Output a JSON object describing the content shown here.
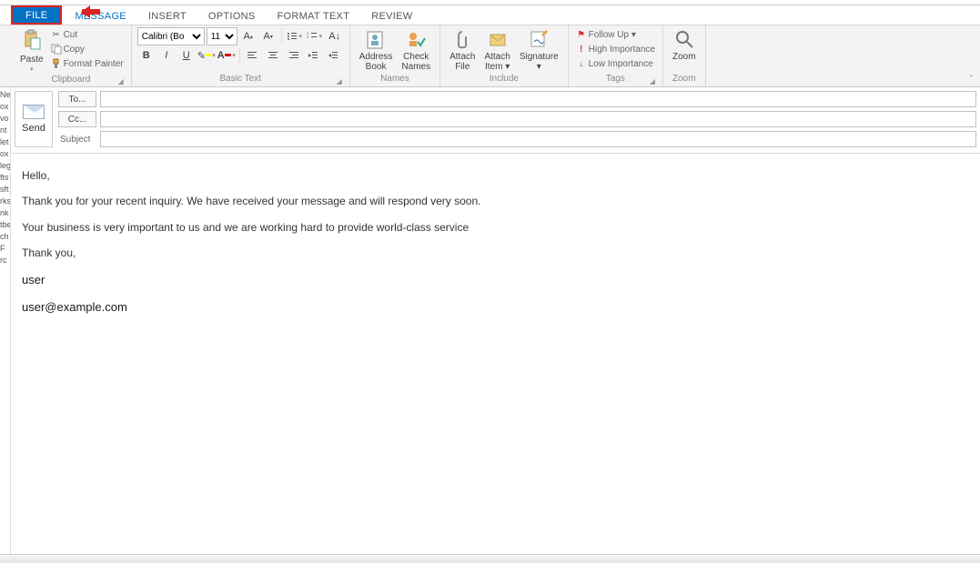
{
  "tabs": {
    "file": "FILE",
    "message": "MESSAGE",
    "insert": "INSERT",
    "options": "OPTIONS",
    "format_text": "FORMAT TEXT",
    "review": "REVIEW"
  },
  "ribbon": {
    "clipboard": {
      "paste": "Paste",
      "cut": "Cut",
      "copy": "Copy",
      "format_painter": "Format Painter",
      "group_label": "Clipboard"
    },
    "basic_text": {
      "font_name": "Calibri (Bo",
      "font_size": "11",
      "group_label": "Basic Text"
    },
    "names": {
      "address_book": "Address\nBook",
      "check_names": "Check\nNames",
      "group_label": "Names"
    },
    "include": {
      "attach_file": "Attach\nFile",
      "attach_item": "Attach\nItem ▾",
      "signature": "Signature\n▾",
      "group_label": "Include"
    },
    "tags": {
      "follow_up": "Follow Up ▾",
      "high": "High Importance",
      "low": "Low Importance",
      "group_label": "Tags"
    },
    "zoom": {
      "zoom": "Zoom",
      "group_label": "Zoom"
    }
  },
  "compose": {
    "send": "Send",
    "to_btn": "To...",
    "cc_btn": "Cc...",
    "subject_label": "Subject",
    "to_value": "",
    "cc_value": "",
    "subject_value": ""
  },
  "message_body": {
    "hello": "Hello,",
    "line1": "Thank you for your recent inquiry. We have received your message and will respond very soon.",
    "line2": "Your business is very important to us and we are working hard to provide world-class service",
    "thanks": "Thank you,",
    "sig_name": "user",
    "sig_email": "user@example.com"
  },
  "nav_sliver": [
    "Ne",
    "ox",
    "vo",
    "nt",
    "let",
    "ox",
    "leg",
    "fts",
    "sft",
    "rks",
    "nk",
    "tbe",
    "ch",
    "F",
    "rc"
  ],
  "colors": {
    "accent": "#0072c6",
    "annotation": "#d22"
  }
}
